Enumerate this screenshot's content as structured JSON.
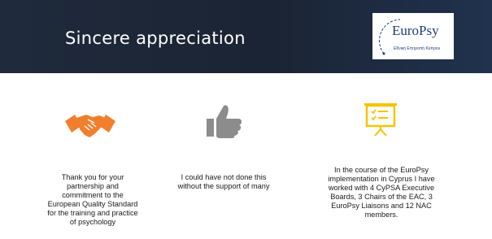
{
  "slide": {
    "title": "Sincere appreciation",
    "logo": {
      "word": "EuroPsy",
      "subtitle": "Εθνική Επιτροπή Κύπρου",
      "arc_text": "ΚΥΠΡΟΣ"
    },
    "items": [
      {
        "icon": "handshake-icon",
        "text": "Thank you for your partnership and commitment to the European Quality Standard for the training and practice of psychology"
      },
      {
        "icon": "thumbs-up-icon",
        "text": "I could have not done this without the support of many"
      },
      {
        "icon": "presentation-board-icon",
        "text": "In the course of the EuroPsy implementation in Cyprus I have worked with 4 CyPSA Executive Boards, 3 Chairs of the EAC, 3 EuroPsy Liaisons and 12 NAC members."
      }
    ]
  },
  "colors": {
    "banner": "#1f2a3c",
    "handshake": "#f07f2d",
    "thumb": "#8c8c8c",
    "board": "#f5c400",
    "logo_text": "#1f3d78"
  }
}
